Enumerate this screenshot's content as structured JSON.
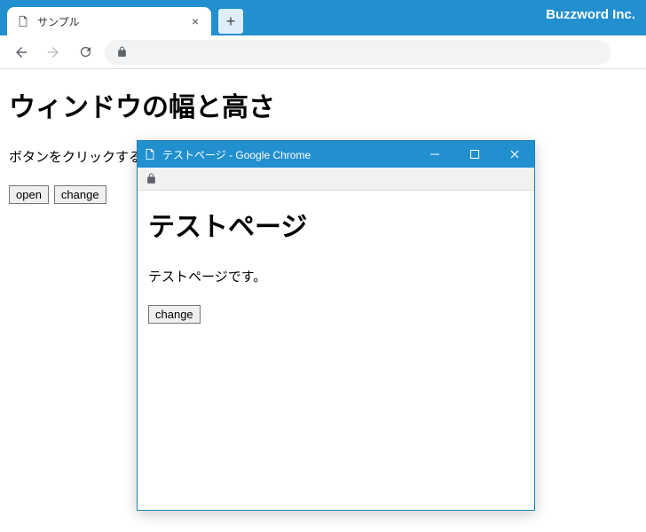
{
  "branding": "Buzzword Inc.",
  "tab": {
    "title": "サンプル"
  },
  "page": {
    "heading": "ウィンドウの幅と高さ",
    "paragraph": "ボタンをクリックすると別ウィンドウでページが開きます。",
    "open_label": "open",
    "change_label": "change"
  },
  "popup": {
    "window_title": "テストページ - Google Chrome",
    "heading": "テストページ",
    "paragraph": "テストページです。",
    "change_label": "change"
  }
}
